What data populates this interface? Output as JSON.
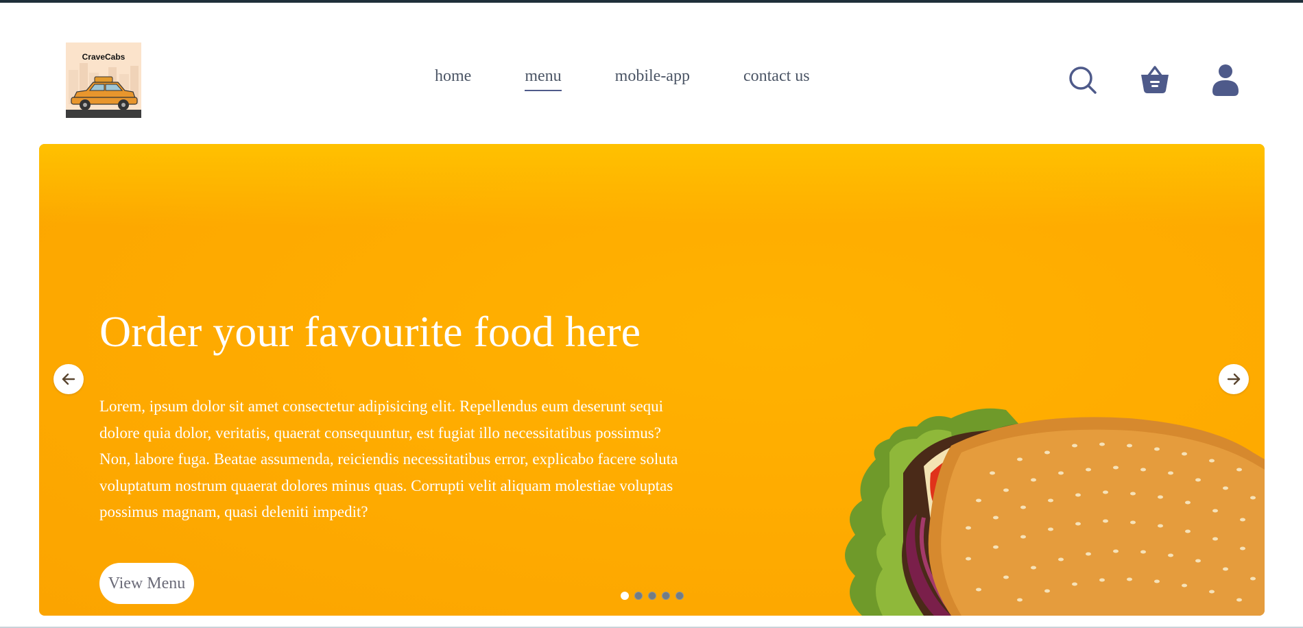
{
  "header": {
    "logo_text": "CraveCabs",
    "nav": [
      {
        "label": "home",
        "active": false
      },
      {
        "label": "menu",
        "active": true
      },
      {
        "label": "mobile-app",
        "active": false
      },
      {
        "label": "contact us",
        "active": false
      }
    ],
    "icons": [
      "search-icon",
      "basket-icon",
      "user-icon"
    ],
    "icon_color": "#4e5a8a"
  },
  "hero": {
    "title": "Order your favourite food here",
    "text": "Lorem, ipsum dolor sit amet consectetur adipisicing elit. Repellendus eum deserunt sequi dolore quia dolor, veritatis, quaerat consequuntur, est fugiat illo necessitatibus possimus? Non, labore fuga. Beatae assumenda, reiciendis necessitatibus error, explicabo facere soluta voluptatum nostrum quaerat dolores minus quas. Corrupti velit aliquam molestiae voluptas possimus magnam, quasi deleniti impedit?",
    "button_label": "View Menu",
    "background_color": "#ffb000",
    "slide_count": 5,
    "active_slide": 1
  }
}
